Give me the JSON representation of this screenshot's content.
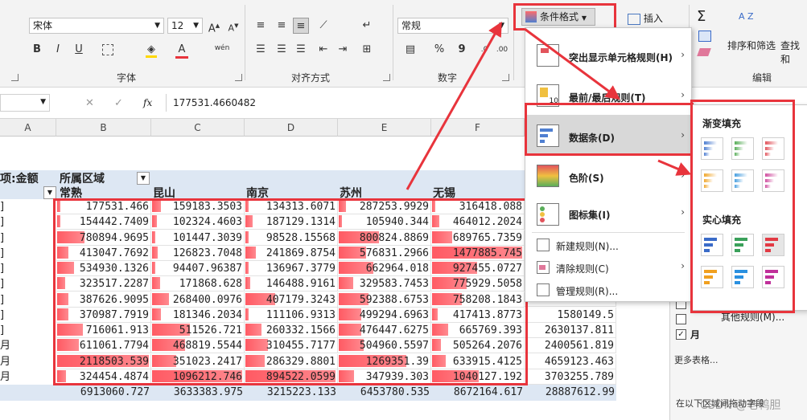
{
  "ribbon": {
    "font_name": "宋体",
    "font_size": "12",
    "number_format": "常规",
    "bold": "B",
    "italic": "I",
    "underline": "U",
    "phonetic": "wén",
    "font_color_letter": "A",
    "percent": "%",
    "comma": "9",
    "group_font": "字体",
    "group_align": "对齐方式",
    "group_number": "数字",
    "group_edit": "编辑",
    "conditional_format": "条件格式",
    "insert": "插入",
    "sort_filter": "排序和筛选",
    "find_select": "查找和",
    "sigma": "Σ",
    "az": "A Z"
  },
  "formula": {
    "cancel": "✕",
    "confirm": "✓",
    "fx": "fx",
    "value": "177531.4660482"
  },
  "columns": [
    "A",
    "B",
    "C",
    "D",
    "E",
    "F"
  ],
  "pivot": {
    "value_label": "项:金额",
    "region_label": "所属区域",
    "cities": [
      "常熟",
      "昆山",
      "南京",
      "苏州",
      "无锡"
    ]
  },
  "rows": [
    {
      "label": "]",
      "values": [
        "177531.466",
        "159183.3503",
        "134313.6071",
        "287253.9929",
        "316418.088"
      ]
    },
    {
      "label": "]",
      "values": [
        "154442.7409",
        "102324.4603",
        "187129.1314",
        "105940.344",
        "464012.2024"
      ]
    },
    {
      "label": "]",
      "values": [
        "780894.9695",
        "101447.3039",
        "98528.15568",
        "800824.8869",
        "689765.7359"
      ]
    },
    {
      "label": "]",
      "values": [
        "413047.7692",
        "126823.7048",
        "241869.8754",
        "576831.2966",
        "1477885.745"
      ]
    },
    {
      "label": "]",
      "values": [
        "534930.1326",
        "94407.96387",
        "136967.3779",
        "662964.018",
        "927455.0727"
      ]
    },
    {
      "label": "]",
      "values": [
        "323517.2287",
        "171868.628",
        "146488.9161",
        "329583.7453",
        "775929.5058"
      ]
    },
    {
      "label": "]",
      "values": [
        "387626.9095",
        "268400.0976",
        "407179.3243",
        "592388.6753",
        "758208.1843"
      ]
    },
    {
      "label": "]",
      "values": [
        "370987.7919",
        "181346.2034",
        "111106.9313",
        "499294.6963",
        "417413.8773"
      ]
    },
    {
      "label": "]",
      "values": [
        "716061.913",
        "511526.721",
        "260332.1566",
        "476447.6275",
        "665769.393"
      ]
    },
    {
      "label": "月",
      "values": [
        "611061.7794",
        "468819.5544",
        "310455.7177",
        "504960.5597",
        "505264.2076"
      ]
    },
    {
      "label": "月",
      "values": [
        "2118503.539",
        "351023.2417",
        "286329.8801",
        "1269351.39",
        "633915.4125"
      ]
    },
    {
      "label": "月",
      "values": [
        "324454.4874",
        "1096212.746",
        "894522.0599",
        "347939.303",
        "1040127.192"
      ]
    }
  ],
  "bar_fractions": [
    [
      0.02,
      0.1,
      0.03,
      0.08,
      0.03
    ],
    [
      0.02,
      0.05,
      0.08,
      0.01,
      0.08
    ],
    [
      0.3,
      0.04,
      0.01,
      0.45,
      0.22
    ],
    [
      0.12,
      0.06,
      0.12,
      0.3,
      1.0
    ],
    [
      0.18,
      0.03,
      0.03,
      0.38,
      0.5
    ],
    [
      0.09,
      0.09,
      0.05,
      0.16,
      0.38
    ],
    [
      0.12,
      0.19,
      0.33,
      0.33,
      0.33
    ],
    [
      0.12,
      0.1,
      0.01,
      0.25,
      0.06
    ],
    [
      0.28,
      0.42,
      0.18,
      0.25,
      0.18
    ],
    [
      0.24,
      0.37,
      0.25,
      0.28,
      0.1
    ],
    [
      1.0,
      0.27,
      0.21,
      0.75,
      0.15
    ],
    [
      0.1,
      1.0,
      1.0,
      0.17,
      0.52
    ]
  ],
  "extra_col": [
    "2413803.191",
    "1580149.5",
    "2630137.811",
    "2400561.819",
    "4659123.463",
    "3703255.789"
  ],
  "totals": [
    "6913060.727",
    "3633383.975",
    "3215223.133",
    "6453780.535",
    "8672164.617",
    "28887612.99"
  ],
  "menu": {
    "highlight_rules": "突出显示单元格规则(H)",
    "top_bottom": "最前/最后规则(T)",
    "data_bars": "数据条(D)",
    "color_scales": "色阶(S)",
    "icon_sets": "图标集(I)",
    "new_rule": "新建规则(N)...",
    "clear_rules": "清除规则(C)",
    "manage_rules": "管理规则(R)..."
  },
  "submenu": {
    "gradient": "渐变填充",
    "solid": "实心填充",
    "other_rules": "其他规则(M)..."
  },
  "side_panel": {
    "month": "月",
    "more_tables": "更多表格...",
    "footer": "在以下区域间拖动字段"
  },
  "watermark": "CSDN @老鸭胆",
  "colors": {
    "accent_red": "#e8343c",
    "bar_red": "#ff5a63",
    "pivot_header": "#dde7f3"
  },
  "swatch_colors": {
    "gradient": [
      "#4f7fd1",
      "#5aae5a",
      "#e2545c",
      "#f0a830",
      "#4aa0e0",
      "#d04fa0"
    ],
    "solid": [
      "#3a6bc8",
      "#3aa05a",
      "#e23a44",
      "#f0a020",
      "#2a90e0",
      "#c0309a"
    ]
  }
}
